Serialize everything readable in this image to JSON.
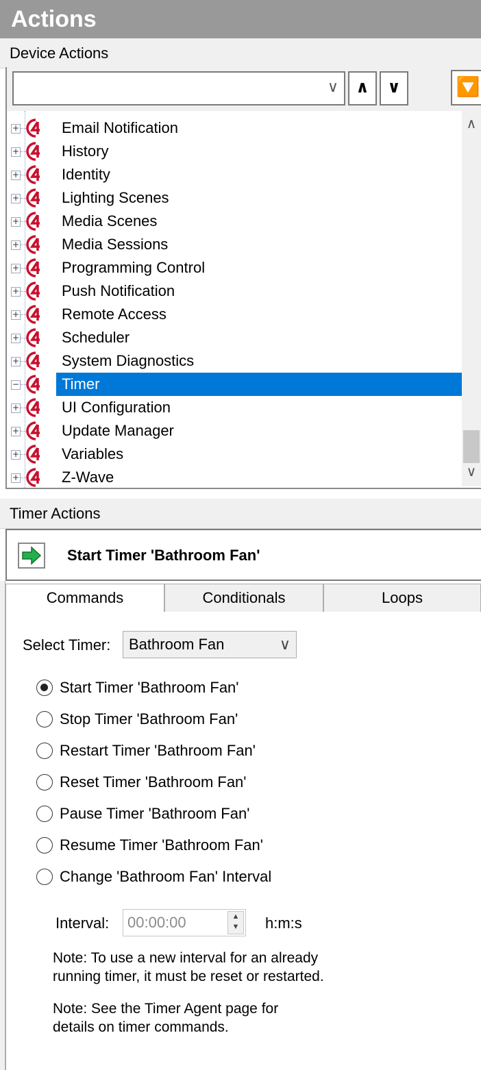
{
  "panel": {
    "title": "Actions"
  },
  "device_actions": {
    "header": "Device Actions",
    "search": {
      "value": ""
    },
    "tree": {
      "items": [
        {
          "label": "Email Notification",
          "expanded": false,
          "selected": false
        },
        {
          "label": "History",
          "expanded": false,
          "selected": false
        },
        {
          "label": "Identity",
          "expanded": false,
          "selected": false
        },
        {
          "label": "Lighting Scenes",
          "expanded": false,
          "selected": false
        },
        {
          "label": "Media Scenes",
          "expanded": false,
          "selected": false
        },
        {
          "label": "Media Sessions",
          "expanded": false,
          "selected": false
        },
        {
          "label": "Programming Control",
          "expanded": false,
          "selected": false
        },
        {
          "label": "Push Notification",
          "expanded": false,
          "selected": false
        },
        {
          "label": "Remote Access",
          "expanded": false,
          "selected": false
        },
        {
          "label": "Scheduler",
          "expanded": false,
          "selected": false
        },
        {
          "label": "System Diagnostics",
          "expanded": false,
          "selected": false
        },
        {
          "label": "Timer",
          "expanded": true,
          "selected": true
        },
        {
          "label": "UI Configuration",
          "expanded": false,
          "selected": false
        },
        {
          "label": "Update Manager",
          "expanded": false,
          "selected": false
        },
        {
          "label": "Variables",
          "expanded": false,
          "selected": false
        },
        {
          "label": "Z-Wave",
          "expanded": false,
          "selected": false
        }
      ]
    }
  },
  "timer_actions": {
    "header": "Timer Actions",
    "selected_action": "Start Timer 'Bathroom Fan'"
  },
  "tabs": [
    {
      "label": "Commands",
      "active": true
    },
    {
      "label": "Conditionals",
      "active": false
    },
    {
      "label": "Loops",
      "active": false
    }
  ],
  "commands": {
    "select_timer_label": "Select Timer:",
    "select_timer_value": "Bathroom Fan",
    "options": [
      {
        "label": "Start Timer 'Bathroom Fan'",
        "checked": true
      },
      {
        "label": "Stop Timer 'Bathroom Fan'",
        "checked": false
      },
      {
        "label": "Restart Timer 'Bathroom Fan'",
        "checked": false
      },
      {
        "label": "Reset Timer 'Bathroom Fan'",
        "checked": false
      },
      {
        "label": "Pause Timer 'Bathroom Fan'",
        "checked": false
      },
      {
        "label": "Resume Timer 'Bathroom Fan'",
        "checked": false
      },
      {
        "label": "Change 'Bathroom Fan' Interval",
        "checked": false
      }
    ],
    "interval_label": "Interval:",
    "interval_value": "00:00:00",
    "interval_unit": "h:m:s",
    "note1_line1": "Note: To use a new interval for an already",
    "note1_line2": "running timer, it must be reset or restarted.",
    "note2_line1": "Note: See the Timer Agent page for",
    "note2_line2": "details on timer commands."
  },
  "colors": {
    "selection": "#0078d7",
    "title_bar": "#999999",
    "control4_red": "#c8102e",
    "go_arrow": "#22b14c"
  }
}
